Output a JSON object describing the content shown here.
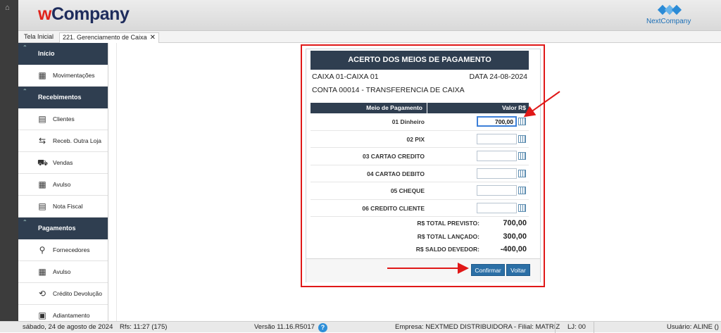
{
  "app": {
    "logo_w": "w",
    "logo_rest": "Company",
    "brand_right": "NextCompany"
  },
  "tabs": [
    {
      "label": "Tela Inicial"
    },
    {
      "label": "221. Gerenciamento de Caixa",
      "close": "✕"
    }
  ],
  "sidebar": {
    "sections": [
      {
        "title": "Início",
        "items": [
          {
            "label": "Movimentações",
            "icon": "cash-register-icon"
          }
        ]
      },
      {
        "title": "Recebimentos",
        "items": [
          {
            "label": "Clientes",
            "icon": "money-stack-icon"
          },
          {
            "label": "Receb. Outra Loja",
            "icon": "money-transfer-icon"
          },
          {
            "label": "Vendas",
            "icon": "cart-icon"
          },
          {
            "label": "Avulso",
            "icon": "calculator-icon"
          },
          {
            "label": "Nota Fiscal",
            "icon": "invoice-icon"
          }
        ]
      },
      {
        "title": "Pagamentos",
        "items": [
          {
            "label": "Fornecedores",
            "icon": "supplier-icon"
          },
          {
            "label": "Avulso",
            "icon": "calculator-icon"
          },
          {
            "label": "Crédito Devolução",
            "icon": "refund-icon"
          },
          {
            "label": "Adiantamento",
            "icon": "advance-icon"
          }
        ]
      }
    ]
  },
  "panel": {
    "title": "ACERTO DOS MEIOS DE PAGAMENTO",
    "caixa": "CAIXA  01-CAIXA 01",
    "data": "DATA  24-08-2024",
    "conta": "CONTA  00014 - TRANSFERENCIA DE CAIXA",
    "grid_headers": [
      "Meio de Pagamento",
      "Valor R$"
    ],
    "rows": [
      {
        "label": "01 Dinheiro",
        "value": "700,00"
      },
      {
        "label": "02 PIX",
        "value": ""
      },
      {
        "label": "03 CARTAO CREDITO",
        "value": ""
      },
      {
        "label": "04 CARTAO DEBITO",
        "value": ""
      },
      {
        "label": "05 CHEQUE",
        "value": ""
      },
      {
        "label": "06 CREDITO CLIENTE",
        "value": ""
      }
    ],
    "totals": [
      {
        "label": "R$ TOTAL PREVISTO:",
        "value": "700,00"
      },
      {
        "label": "R$ TOTAL LANÇADO:",
        "value": "300,00"
      },
      {
        "label": "R$ SALDO DEVEDOR:",
        "value": "-400,00"
      }
    ],
    "confirm_label": "Confirmar",
    "back_label": "Voltar"
  },
  "status": {
    "date": "sábado, 24 de agosto de 2024",
    "rfs": "Rfs: 11:27 (175)",
    "version": "Versão 11.16.R5017",
    "help": "?",
    "empresa": "Empresa: NEXTMED DISTRIBUIDORA - Filial: MATRIZ",
    "lj": "LJ: 00",
    "usuario": "Usuário: ALINE ()"
  },
  "colors": {
    "header_dark": "#2f3e50",
    "accent_red": "#e01818",
    "button_blue": "#2b6fa6"
  }
}
